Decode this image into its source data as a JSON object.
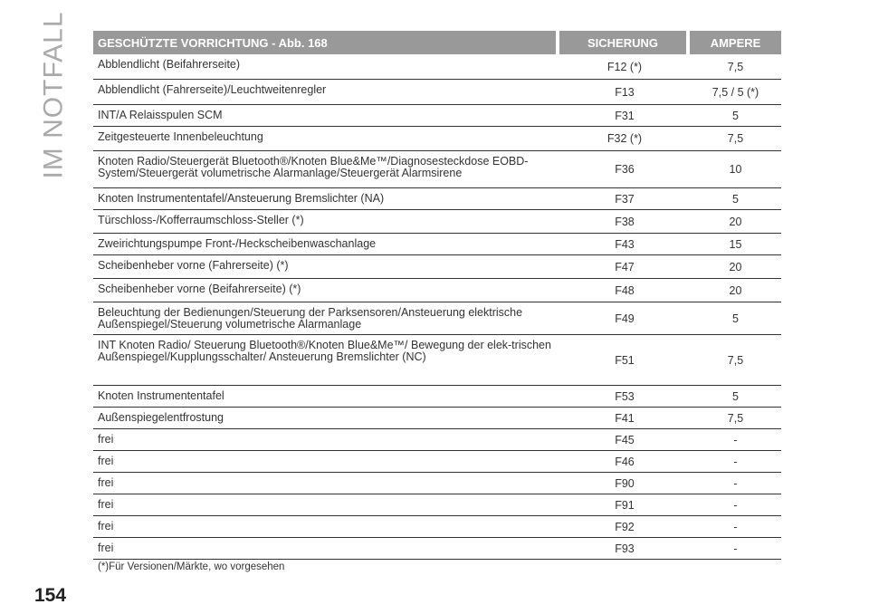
{
  "side_title": "IM NOTFALL",
  "page_number": "154",
  "table": {
    "headers": {
      "device": "GESCHÜTZTE VORRICHTUNG - Abb. 168",
      "fuse": "SICHERUNG",
      "amps": "AMPERE"
    },
    "rows": [
      {
        "device": "Abblendlicht (Beifahrerseite)",
        "fuse": "F12 (*)",
        "amps": "7,5"
      },
      {
        "device": "Abblendlicht (Fahrerseite)/Leuchtweitenregler",
        "fuse": "F13",
        "amps": "7,5 / 5 (*)"
      },
      {
        "device": "INT/A Relaisspulen SCM",
        "fuse": "F31",
        "amps": "5"
      },
      {
        "device": "Zeitgesteuerte Innenbeleuchtung",
        "fuse": "F32 (*)",
        "amps": "7,5"
      },
      {
        "device": "Knoten Radio/Steuergerät Bluetooth®/Knoten Blue&Me™/Diagnosesteckdose EOBD-System/Steuergerät volumetrische Alarmanlage/Steuergerät Alarmsirene",
        "fuse": "F36",
        "amps": "10"
      },
      {
        "device": "Knoten Instrumententafel/Ansteuerung Bremslichter (NA)",
        "fuse": "F37",
        "amps": "5"
      },
      {
        "device": "Türschloss-/Kofferraumschloss-Steller (*)",
        "fuse": "F38",
        "amps": "20"
      },
      {
        "device": "Zweirichtungspumpe Front-/Heckscheibenwaschanlage",
        "fuse": "F43",
        "amps": "15"
      },
      {
        "device": "Scheibenheber vorne (Fahrerseite) (*)",
        "fuse": "F47",
        "amps": "20"
      },
      {
        "device": "Scheibenheber vorne (Beifahrerseite) (*)",
        "fuse": "F48",
        "amps": "20"
      },
      {
        "device": "Beleuchtung der Bedienungen/Steuerung der Parksensoren/Ansteuerung elektrische Außenspiegel/Steuerung volumetrische Alarmanlage",
        "fuse": "F49",
        "amps": "5"
      },
      {
        "device": "INT Knoten Radio/ Steuerung Bluetooth®/Knoten Blue&Me™/ Bewegung der elek-trischen Außenspiegel/Kupplungsschalter/ Ansteuerung Bremslichter (NC)",
        "fuse": "F51",
        "amps": "7,5"
      },
      {
        "device": "Knoten Instrumententafel",
        "fuse": "F53",
        "amps": "5"
      },
      {
        "device": "Außenspiegelentfrostung",
        "fuse": "F41",
        "amps": "7,5"
      },
      {
        "device": "frei",
        "fuse": "F45",
        "amps": "-"
      },
      {
        "device": "frei",
        "fuse": "F46",
        "amps": "-"
      },
      {
        "device": "frei",
        "fuse": "F90",
        "amps": "-"
      },
      {
        "device": "frei",
        "fuse": "F91",
        "amps": "-"
      },
      {
        "device": "frei",
        "fuse": "F92",
        "amps": "-"
      },
      {
        "device": "frei",
        "fuse": "F93",
        "amps": "-"
      }
    ]
  },
  "footnote": "(*)Für Versionen/Märkte, wo vorgesehen"
}
